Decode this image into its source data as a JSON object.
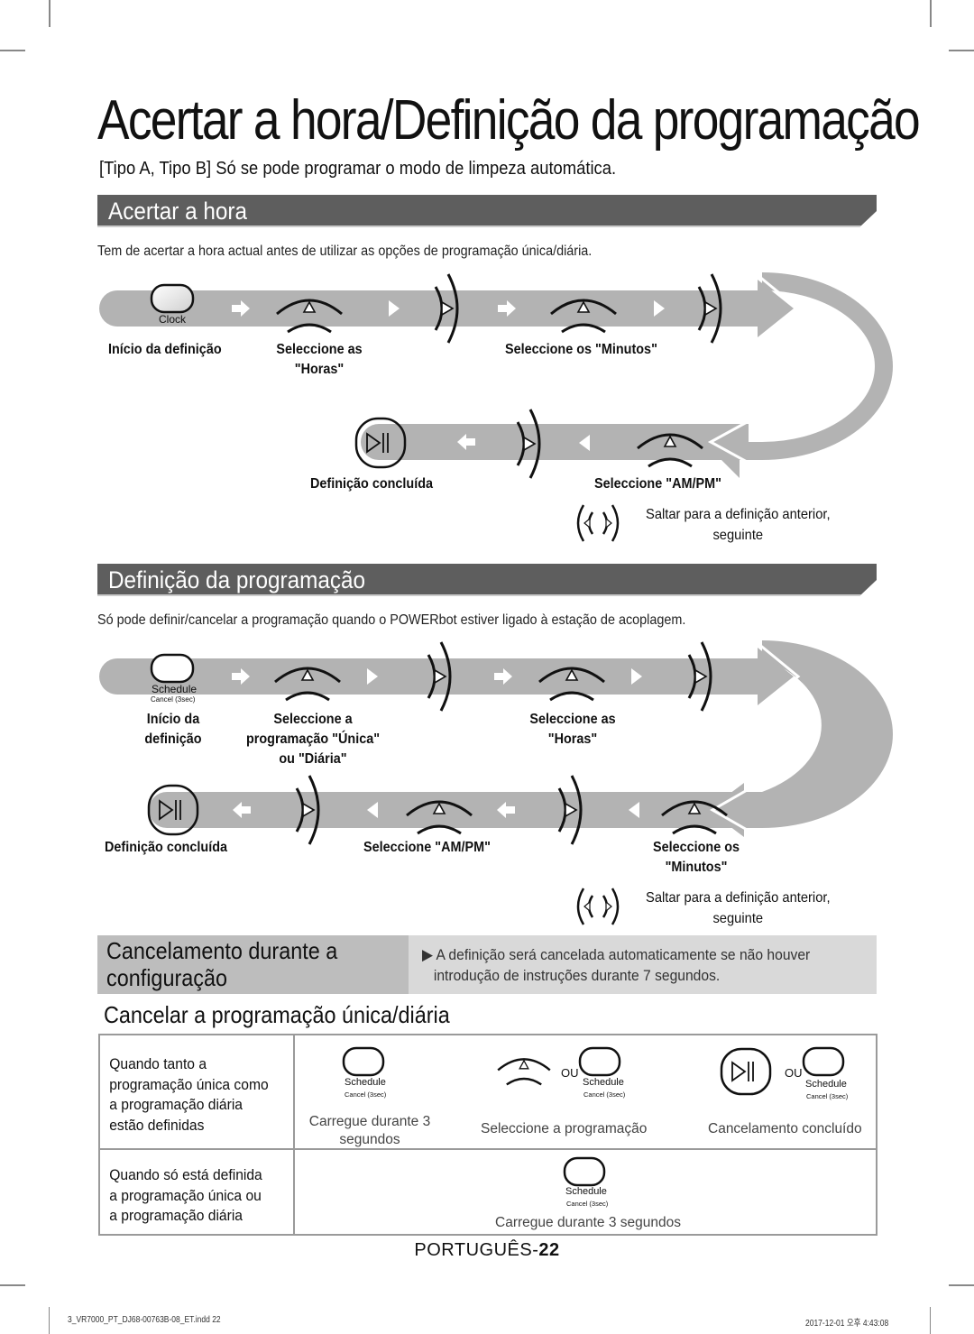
{
  "page": {
    "title": "Acertar a hora/Definição da programação",
    "subtitle": "[Tipo A, Tipo B] Só se pode programar o modo de limpeza automática.",
    "page_label": "PORTUGUÊS-",
    "page_number": "22",
    "slug_file": "3_VR7000_PT_DJ68-00763B-08_ET.indd   22",
    "slug_date": "2017-12-01   오후 4:43:08"
  },
  "colors": {
    "section_bar": "#5e5e5e",
    "flow_band": "#b3b3b3",
    "cancel_box_dark": "#bdbdbd",
    "cancel_box_light": "#d9d9d9",
    "table_border": "#9a9a9a"
  },
  "set_time": {
    "heading": "Acertar a hora",
    "description": "Tem de acertar a hora actual antes de utilizar as opções de programação única/diária.",
    "button_caption": "Clock",
    "steps": [
      {
        "label": "Início da definição",
        "icon": "clock-button-icon"
      },
      {
        "label": "Seleccione as \"Horas\"",
        "icon": "up-down-dial-icon"
      },
      {
        "label": "Seleccione os \"Minutos\"",
        "icon": "up-down-dial-icon"
      },
      {
        "label": "Seleccione \"AM/PM\"",
        "icon": "up-down-dial-icon"
      },
      {
        "label": "Definição concluída",
        "icon": "play-pause-button-icon"
      }
    ],
    "step1_line1": "Início da definição",
    "step2_line1": "Seleccione as",
    "step2_line2": "\"Horas\"",
    "step3_line1": "Seleccione os \"Minutos\"",
    "step4_line1": "Seleccione \"AM/PM\"",
    "step5_line1": "Definição concluída",
    "skip_line1": "Saltar para a definição anterior,",
    "skip_line2": "seguinte"
  },
  "set_schedule": {
    "heading": "Definição da programação",
    "description": "Só pode definir/cancelar a programação quando o POWERbot estiver ligado à estação de acoplagem.",
    "button_caption": "Schedule",
    "button_subcaption": "Cancel (3sec)",
    "step1_line1": "Início da",
    "step1_line2": "definição",
    "step2_line1": "Seleccione a",
    "step2_line2": "programação \"Única\"",
    "step2_line3": "ou \"Diária\"",
    "step3_line1": "Seleccione as",
    "step3_line2": "\"Horas\"",
    "step4_line1": "Seleccione os",
    "step4_line2": "\"Minutos\"",
    "step5_line1": "Seleccione \"AM/PM\"",
    "step6_line1": "Definição concluída",
    "skip_line1": "Saltar para a definição anterior,",
    "skip_line2": "seguinte"
  },
  "cancel_during_setup": {
    "title_line1": "Cancelamento durante a",
    "title_line2": "configuração",
    "icon": "power-button-icon",
    "text_line1": "▶ A definição será cancelada automaticamente se não houver",
    "text_line2": "introdução de instruções durante 7 segundos."
  },
  "cancel_schedule": {
    "heading": "Cancelar a programação única/diária",
    "or_label": "OU",
    "schedule_caption": "Schedule",
    "schedule_subcaption": "Cancel (3sec)",
    "rows": [
      {
        "condition_lines": [
          "Quando tanto a",
          "programação única como",
          "a programação diária",
          "estão definidas"
        ],
        "step1_line1": "Carregue durante 3",
        "step1_line2": "segundos",
        "step2": "Seleccione a programação",
        "step3": "Cancelamento concluído"
      },
      {
        "condition_lines": [
          "Quando só está definida",
          "a programação única ou",
          "a programação diária"
        ],
        "step1": "Carregue durante 3 segundos"
      }
    ]
  }
}
